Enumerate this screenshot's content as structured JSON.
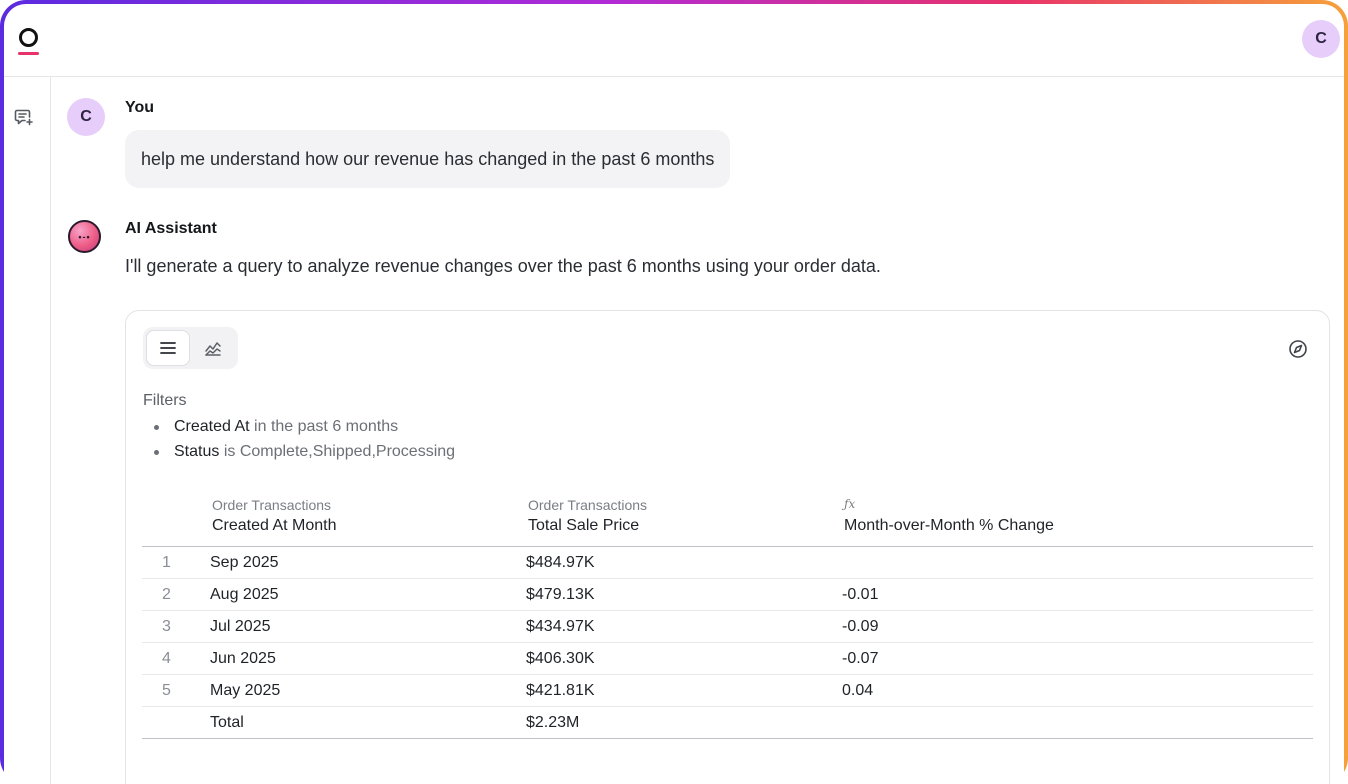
{
  "header": {
    "user_initial": "C"
  },
  "conversation": {
    "user": {
      "initial": "C",
      "name": "You",
      "message": "help me understand how our revenue has changed in the past 6 months"
    },
    "assistant": {
      "name": "AI Assistant",
      "message": "I'll generate a query to analyze revenue changes over the past 6 months using your order data."
    }
  },
  "result": {
    "filters_title": "Filters",
    "filters": [
      {
        "field": "Created At",
        "condition": "in the past 6 months"
      },
      {
        "field": "Status",
        "operator": "is",
        "value": "Complete,Shipped,Processing"
      }
    ],
    "columns": [
      {
        "group": "Order Transactions",
        "name": "Created At Month"
      },
      {
        "group": "Order Transactions",
        "name": "Total Sale Price"
      },
      {
        "group": "fx",
        "name": "Month-over-Month % Change"
      }
    ],
    "rows": [
      {
        "index": "1",
        "month": "Sep 2025",
        "price": "$484.97K",
        "change": ""
      },
      {
        "index": "2",
        "month": "Aug 2025",
        "price": "$479.13K",
        "change": "-0.01"
      },
      {
        "index": "3",
        "month": "Jul 2025",
        "price": "$434.97K",
        "change": "-0.09"
      },
      {
        "index": "4",
        "month": "Jun 2025",
        "price": "$406.30K",
        "change": "-0.07"
      },
      {
        "index": "5",
        "month": "May 2025",
        "price": "$421.81K",
        "change": "0.04"
      }
    ],
    "total": {
      "label": "Total",
      "price": "$2.23M"
    }
  },
  "icons": {
    "logo": "lightdash-logo",
    "new_chat": "new-chat-icon",
    "table_view": "list-icon",
    "chart_view": "chart-icon",
    "explore": "compass-icon"
  },
  "colors": {
    "accent_pink": "#e8326a",
    "avatar_bg": "#e6cdfa",
    "frame_gradient_start": "#5b2be0",
    "frame_gradient_end": "#f6a13a"
  }
}
